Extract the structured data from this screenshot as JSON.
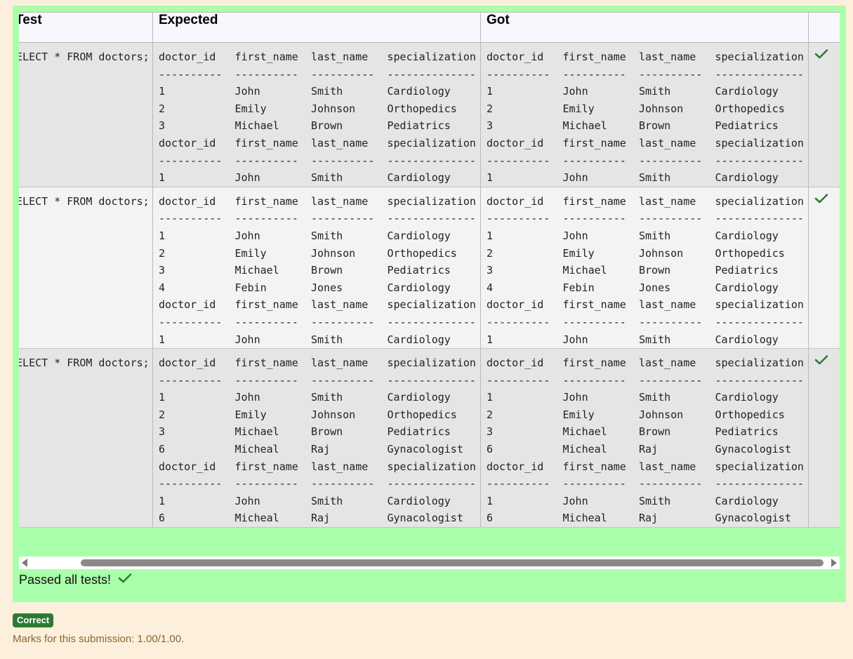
{
  "table": {
    "headers": [
      "Test",
      "Expected",
      "Got",
      ""
    ],
    "rows": [
      {
        "test": "SELECT * FROM doctors;",
        "expected": [
          [
            "doctor_id",
            "first_name",
            "last_name",
            "specialization"
          ],
          [
            "----------",
            "----------",
            "----------",
            "--------------"
          ],
          [
            "1",
            "John",
            "Smith",
            "Cardiology"
          ],
          [
            "2",
            "Emily",
            "Johnson",
            "Orthopedics"
          ],
          [
            "3",
            "Michael",
            "Brown",
            "Pediatrics"
          ],
          [
            "doctor_id",
            "first_name",
            "last_name",
            "specialization"
          ],
          [
            "----------",
            "----------",
            "----------",
            "--------------"
          ],
          [
            "1",
            "John",
            "Smith",
            "Cardiology"
          ]
        ],
        "got": [
          [
            "doctor_id",
            "first_name",
            "last_name",
            "specialization"
          ],
          [
            "----------",
            "----------",
            "----------",
            "--------------"
          ],
          [
            "1",
            "John",
            "Smith",
            "Cardiology"
          ],
          [
            "2",
            "Emily",
            "Johnson",
            "Orthopedics"
          ],
          [
            "3",
            "Michael",
            "Brown",
            "Pediatrics"
          ],
          [
            "doctor_id",
            "first_name",
            "last_name",
            "specialization"
          ],
          [
            "----------",
            "----------",
            "----------",
            "--------------"
          ],
          [
            "1",
            "John",
            "Smith",
            "Cardiology"
          ]
        ],
        "status_icon": "check-icon"
      },
      {
        "test": "SELECT * FROM doctors;",
        "expected": [
          [
            "doctor_id",
            "first_name",
            "last_name",
            "specialization"
          ],
          [
            "----------",
            "----------",
            "----------",
            "--------------"
          ],
          [
            "1",
            "John",
            "Smith",
            "Cardiology"
          ],
          [
            "2",
            "Emily",
            "Johnson",
            "Orthopedics"
          ],
          [
            "3",
            "Michael",
            "Brown",
            "Pediatrics"
          ],
          [
            "4",
            "Febin",
            "Jones",
            "Cardiology"
          ],
          [
            "doctor_id",
            "first_name",
            "last_name",
            "specialization"
          ],
          [
            "----------",
            "----------",
            "----------",
            "--------------"
          ],
          [
            "1",
            "John",
            "Smith",
            "Cardiology"
          ]
        ],
        "got": [
          [
            "doctor_id",
            "first_name",
            "last_name",
            "specialization"
          ],
          [
            "----------",
            "----------",
            "----------",
            "--------------"
          ],
          [
            "1",
            "John",
            "Smith",
            "Cardiology"
          ],
          [
            "2",
            "Emily",
            "Johnson",
            "Orthopedics"
          ],
          [
            "3",
            "Michael",
            "Brown",
            "Pediatrics"
          ],
          [
            "4",
            "Febin",
            "Jones",
            "Cardiology"
          ],
          [
            "doctor_id",
            "first_name",
            "last_name",
            "specialization"
          ],
          [
            "----------",
            "----------",
            "----------",
            "--------------"
          ],
          [
            "1",
            "John",
            "Smith",
            "Cardiology"
          ]
        ],
        "status_icon": "check-icon"
      },
      {
        "test": "SELECT * FROM doctors;",
        "expected": [
          [
            "doctor_id",
            "first_name",
            "last_name",
            "specialization"
          ],
          [
            "----------",
            "----------",
            "----------",
            "--------------"
          ],
          [
            "1",
            "John",
            "Smith",
            "Cardiology"
          ],
          [
            "2",
            "Emily",
            "Johnson",
            "Orthopedics"
          ],
          [
            "3",
            "Michael",
            "Brown",
            "Pediatrics"
          ],
          [
            "6",
            "Micheal",
            "Raj",
            "Gynacologist"
          ],
          [
            "doctor_id",
            "first_name",
            "last_name",
            "specialization"
          ],
          [
            "----------",
            "----------",
            "----------",
            "--------------"
          ],
          [
            "1",
            "John",
            "Smith",
            "Cardiology"
          ],
          [
            "6",
            "Micheal",
            "Raj",
            "Gynacologist"
          ]
        ],
        "got": [
          [
            "doctor_id",
            "first_name",
            "last_name",
            "specialization"
          ],
          [
            "----------",
            "----------",
            "----------",
            "--------------"
          ],
          [
            "1",
            "John",
            "Smith",
            "Cardiology"
          ],
          [
            "2",
            "Emily",
            "Johnson",
            "Orthopedics"
          ],
          [
            "3",
            "Michael",
            "Brown",
            "Pediatrics"
          ],
          [
            "6",
            "Micheal",
            "Raj",
            "Gynacologist"
          ],
          [
            "doctor_id",
            "first_name",
            "last_name",
            "specialization"
          ],
          [
            "----------",
            "----------",
            "----------",
            "--------------"
          ],
          [
            "1",
            "John",
            "Smith",
            "Cardiology"
          ],
          [
            "6",
            "Micheal",
            "Raj",
            "Gynacologist"
          ]
        ],
        "status_icon": "check-icon"
      }
    ]
  },
  "summary": {
    "passed_text": "Passed all tests!",
    "passed_icon": "check-icon"
  },
  "grade": {
    "badge": "Correct",
    "marks_text": "Marks for this submission: 1.00/1.00."
  },
  "colors": {
    "panel_bg": "#aaffaa",
    "page_bg": "#fcefdc",
    "check": "#2f7a32",
    "badge_bg": "#2f7a32",
    "marks_text": "#8a6530"
  }
}
